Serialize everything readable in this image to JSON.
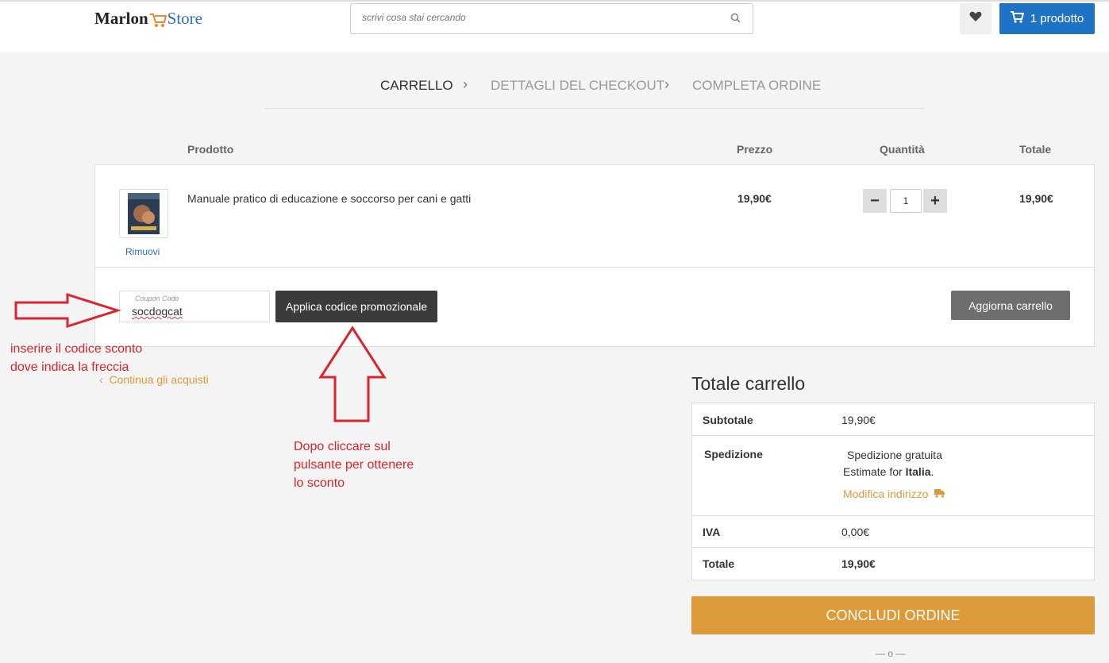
{
  "header": {
    "logo_left": "Marlon",
    "logo_right": "Store",
    "search_placeholder": "scrivi cosa stai cercando",
    "cart_label": "1 prodotto"
  },
  "steps": [
    "CARRELLO",
    "DETTAGLI DEL CHECKOUT",
    "COMPLETA ORDINE"
  ],
  "table": {
    "col_product": "Prodotto",
    "col_price": "Prezzo",
    "col_qty": "Quantità",
    "col_total": "Totale",
    "item": {
      "name": "Manuale pratico di educazione e soccorso per cani e gatti",
      "price": "19,90€",
      "qty": "1",
      "total": "19,90€",
      "remove_label": "Rimuovi"
    }
  },
  "coupon": {
    "label": "Coupon Code",
    "value": "socdogcat",
    "apply_label": "Applica codice promozionale"
  },
  "update_label": "Aggiorna carrello",
  "continue_label": "Continua gli acquisti",
  "annotations": {
    "left_line1": "inserire il codice sconto",
    "left_line2": "dove indica la freccia",
    "mid_line1": "Dopo cliccare sul",
    "mid_line2": "pulsante per ottenere",
    "mid_line3": "lo sconto"
  },
  "totals": {
    "title": "Totale carrello",
    "subtotal_label": "Subtotale",
    "subtotal_value": "19,90€",
    "shipping_label": "Spedizione",
    "shipping_value": "Spedizione gratuita",
    "estimate_prefix": "Estimate for",
    "estimate_country": "Italia",
    "estimate_suffix": ".",
    "change_address": "Modifica indirizzo",
    "vat_label": "IVA",
    "vat_value": "0,00€",
    "total_label": "Totale",
    "total_value": "19,90€"
  },
  "checkout_label": "CONCLUDI ORDINE",
  "or_label": "— o —",
  "colors": {
    "brand_blue": "#1f73c4",
    "accent_orange": "#dd9a38",
    "annotation_red": "#d9252b"
  }
}
